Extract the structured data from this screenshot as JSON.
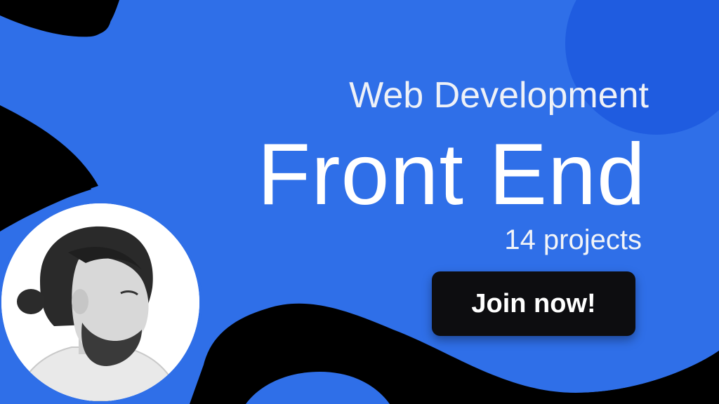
{
  "banner": {
    "subtitle": "Web Development",
    "title": "Front End",
    "project_count": "14 projects",
    "cta_label": "Join now!"
  },
  "colors": {
    "background": "#000000",
    "blob_blue": "#2f6fe8",
    "accent_circle": "#1f5ce0",
    "button_bg": "#0d0d10",
    "text": "#ffffff"
  },
  "avatar": {
    "icon": "person-portrait-illustration"
  }
}
